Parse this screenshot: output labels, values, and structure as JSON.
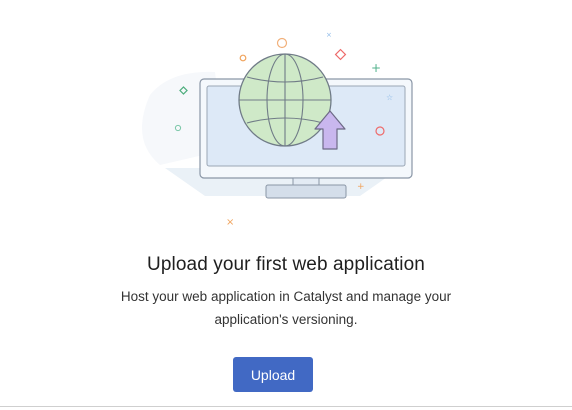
{
  "empty_state": {
    "title": "Upload your first web application",
    "description_line1": "Host your web application in Catalyst and manage your",
    "description_line2": "application's versioning.",
    "upload_button_label": "Upload"
  },
  "illustration": {
    "icon": "globe-on-monitor-upload-icon",
    "colors": {
      "globe": "#cfe9c8",
      "monitor_screen": "#dde9f7",
      "arrow": "#c9b7ee",
      "button": "#4169c4"
    }
  }
}
